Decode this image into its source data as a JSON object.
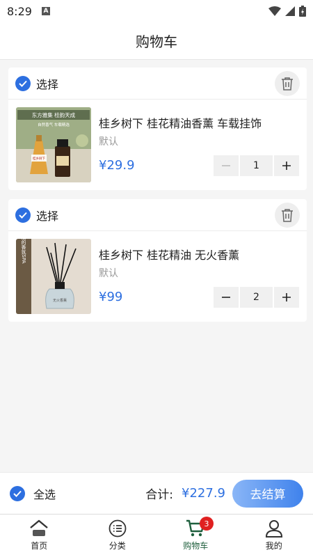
{
  "status_bar": {
    "time": "8:29",
    "notification_icon": "A"
  },
  "header": {
    "title": "购物车"
  },
  "cart": {
    "shops": [
      {
        "select_label": "选择",
        "product": {
          "name": "桂乡树下 桂花精油香薰 车载挂饰",
          "spec": "默认",
          "price": "¥29.9",
          "quantity": "1",
          "image_texts": [
            "东方雅集 桂韵天成",
            "自然香气 车载精选",
            "桂乡树下"
          ]
        }
      },
      {
        "select_label": "选择",
        "product": {
          "name": "桂乡树下 桂花精油 无火香薰",
          "spec": "默认",
          "price": "¥99",
          "quantity": "2",
          "image_texts": [
            "给生活的香氛SPA",
            "无火香薰"
          ]
        }
      }
    ]
  },
  "footer": {
    "select_all_label": "全选",
    "total_label": "合计:",
    "total_value": "¥227.9",
    "checkout_label": "去结算"
  },
  "tabbar": {
    "items": [
      {
        "label": "首页",
        "icon": "home-icon"
      },
      {
        "label": "分类",
        "icon": "category-icon"
      },
      {
        "label": "购物车",
        "icon": "cart-icon",
        "badge": "3",
        "active": true
      },
      {
        "label": "我的",
        "icon": "profile-icon"
      }
    ]
  },
  "colors": {
    "accent": "#2d6fe0",
    "active_tab": "#1f5f3d",
    "badge": "#e02020",
    "background": "#f5f5f5"
  }
}
